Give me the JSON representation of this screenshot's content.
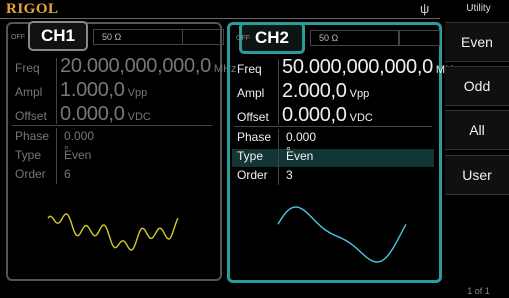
{
  "header": {
    "logo": "RIGOL",
    "usb_icon": "usb-icon",
    "menu_title": "Utility"
  },
  "ch1": {
    "tab_label": "CH1",
    "output_state": "OFF",
    "impedance": "50 Ω",
    "freq_label": "Freq",
    "freq_value": "20.000,000,000,0",
    "freq_unit": "MHz",
    "ampl_label": "Ampl",
    "ampl_value": "1.000,0",
    "ampl_unit": "Vpp",
    "offset_label": "Offset",
    "offset_value": "0.000,0",
    "offset_unit": "VDC",
    "phase_label": "Phase",
    "phase_value": "0.000 °",
    "type_label": "Type",
    "type_value": "Even",
    "order_label": "Order",
    "order_value": "6",
    "wave_color": "#d6c92a"
  },
  "ch2": {
    "tab_label": "CH2",
    "output_state": "OFF",
    "impedance": "50 Ω",
    "freq_label": "Freq",
    "freq_value": "50.000,000,000,0",
    "freq_unit": "MHz",
    "ampl_label": "Ampl",
    "ampl_value": "2.000,0",
    "ampl_unit": "Vpp",
    "offset_label": "Offset",
    "offset_value": "0.000,0",
    "offset_unit": "VDC",
    "phase_label": "Phase",
    "phase_value": "0.000 °",
    "type_label": "Type",
    "type_value": "Even",
    "order_label": "Order",
    "order_value": "3",
    "wave_color": "#4fc6df",
    "accent_color": "#2a9d9b"
  },
  "softkeys": [
    {
      "label": "Even"
    },
    {
      "label": "Odd"
    },
    {
      "label": "All"
    },
    {
      "label": "User"
    }
  ],
  "page_indicator": "1 of 1"
}
